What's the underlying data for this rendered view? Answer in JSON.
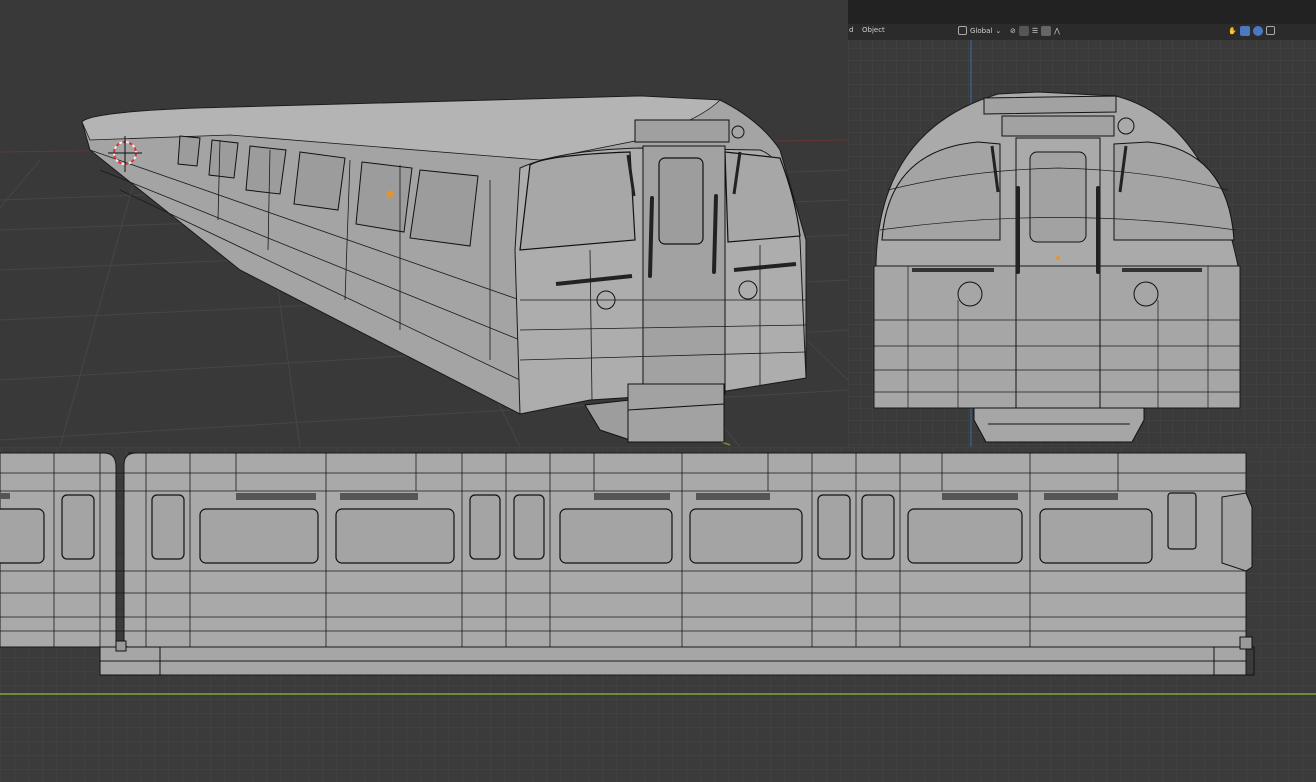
{
  "app": "3D modeling viewport",
  "header": {
    "mode_menu": "Object",
    "transform_orientation": "Global",
    "left_fragment": "d"
  },
  "viewports": {
    "perspective": {
      "view": "User Perspective"
    },
    "front": {
      "view": "Front Orthographic"
    },
    "side": {
      "view": "Right Orthographic"
    }
  },
  "colors": {
    "viewport_bg": "#393939",
    "grid": "#444444",
    "mesh_face": "#a9a9a9",
    "mesh_edge": "#1a1a1a",
    "x_axis": "#8a3b3b",
    "y_axis": "#7fa635",
    "z_axis": "#3f6aa8",
    "origin": "#e8922e"
  },
  "icons": [
    "orientation-icon",
    "pivot-icon",
    "snap-icon",
    "proportional-icon",
    "view-gizmo-icon",
    "overlay-icon",
    "xray-icon"
  ]
}
